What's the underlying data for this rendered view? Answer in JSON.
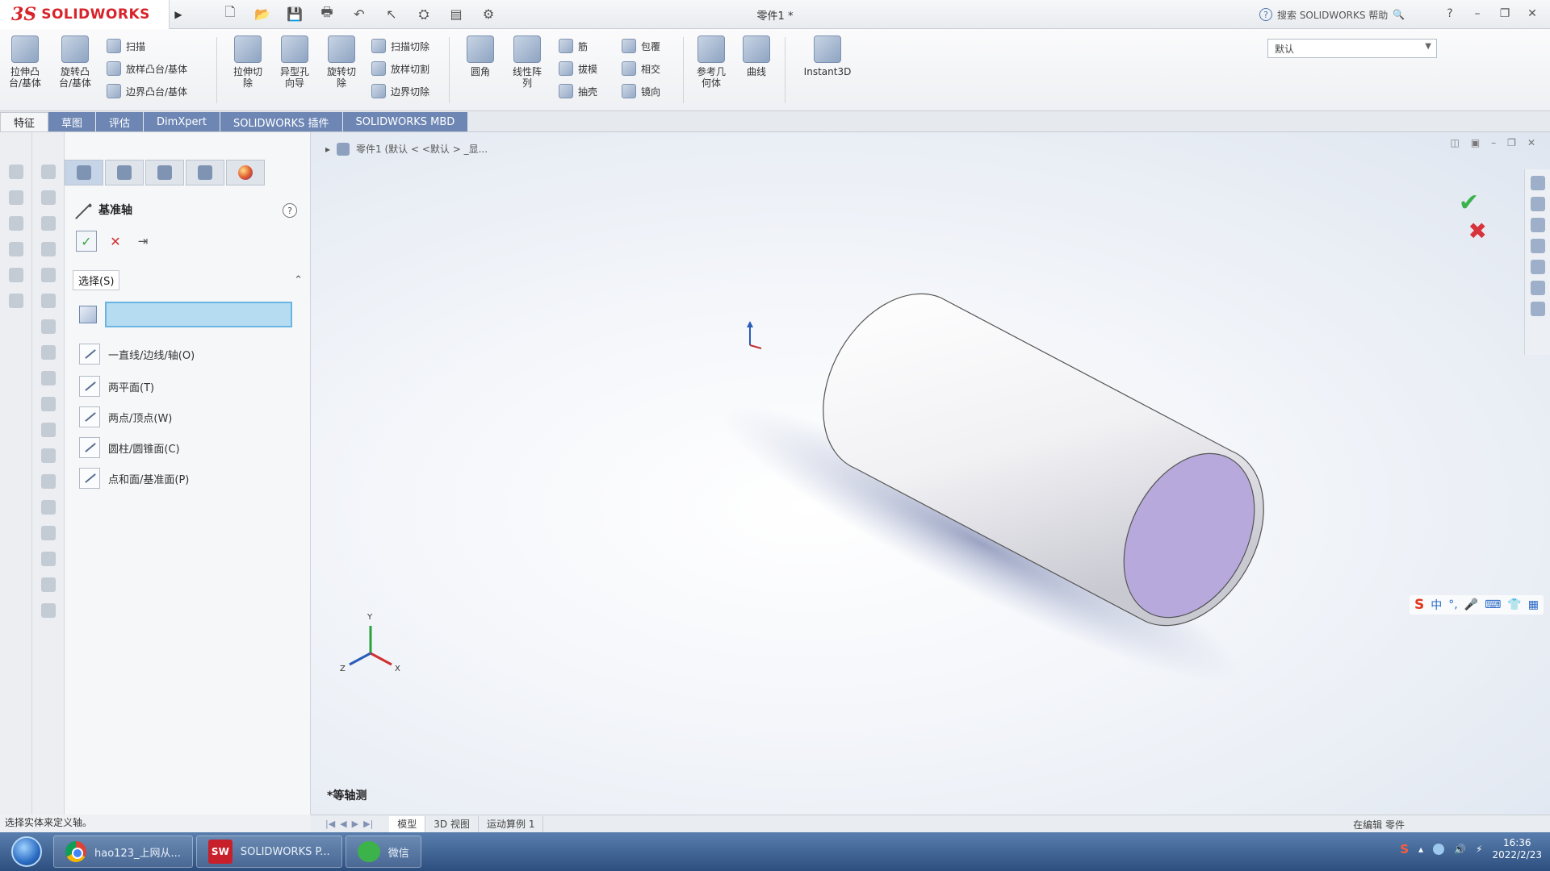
{
  "app": {
    "brand": "SOLIDWORKS",
    "doc_title": "零件1 *",
    "help_search": "搜索 SOLIDWORKS 帮助"
  },
  "ribbon": {
    "large": [
      {
        "label": "拉伸凸\n台/基体",
        "icon": "extrude-boss-icon"
      },
      {
        "label": "旋转凸\n台/基体",
        "icon": "revolve-boss-icon"
      },
      {
        "label": "拉伸切\n除",
        "icon": "extrude-cut-icon"
      },
      {
        "label": "异型孔\n向导",
        "icon": "hole-wizard-icon"
      },
      {
        "label": "旋转切\n除",
        "icon": "revolve-cut-icon"
      },
      {
        "label": "圆角",
        "icon": "fillet-icon"
      },
      {
        "label": "线性阵\n列",
        "icon": "linear-pattern-icon"
      },
      {
        "label": "参考几\n何体",
        "icon": "reference-geometry-icon"
      },
      {
        "label": "曲线",
        "icon": "curves-icon"
      },
      {
        "label": "Instant3D",
        "icon": "instant3d-icon"
      }
    ],
    "small": [
      {
        "label": "扫描",
        "icon": "sweep-icon"
      },
      {
        "label": "放样凸台/基体",
        "icon": "loft-icon"
      },
      {
        "label": "边界凸台/基体",
        "icon": "boundary-boss-icon"
      },
      {
        "label": "扫描切除",
        "icon": "swept-cut-icon"
      },
      {
        "label": "放样切割",
        "icon": "lofted-cut-icon"
      },
      {
        "label": "边界切除",
        "icon": "boundary-cut-icon"
      },
      {
        "label": "筋",
        "icon": "rib-icon"
      },
      {
        "label": "包覆",
        "icon": "wrap-icon"
      },
      {
        "label": "拔模",
        "icon": "draft-icon"
      },
      {
        "label": "相交",
        "icon": "intersect-icon"
      },
      {
        "label": "抽壳",
        "icon": "shell-icon"
      },
      {
        "label": "镜向",
        "icon": "mirror-icon"
      }
    ],
    "config_combo": "默认"
  },
  "tabs": [
    "特征",
    "草图",
    "评估",
    "DimXpert",
    "SOLIDWORKS 插件",
    "SOLIDWORKS MBD"
  ],
  "property_manager": {
    "title": "基准轴",
    "selection_label": "选择(S)",
    "options": [
      "一直线/边线/轴(O)",
      "两平面(T)",
      "两点/顶点(W)",
      "圆柱/圆锥面(C)",
      "点和面/基准面(P)"
    ]
  },
  "graphics": {
    "breadcrumb": "零件1  (默认 < <默认 > _显...",
    "view_label": "*等轴测",
    "ime": [
      "中",
      "°,",
      "🎤"
    ]
  },
  "model_tabs": [
    "模型",
    "3D 视图",
    "运动算例 1"
  ],
  "status": {
    "message": "选择实体来定义轴。",
    "editing": "在编辑 零件"
  },
  "taskbar": {
    "items": [
      {
        "label": "hao123_上网从...",
        "icon": "chrome-icon"
      },
      {
        "label": "SOLIDWORKS P...",
        "icon": "solidworks-icon"
      },
      {
        "label": "微信",
        "icon": "wechat-icon"
      }
    ],
    "time": "16:36",
    "date": "2022/2/23"
  },
  "colors": {
    "accent": "#6d86b4",
    "selection_box": "#b5dcf1",
    "cylinder_face": "#b8a9dc",
    "ok_green": "#3ab34a",
    "cancel_red": "#d8323a"
  }
}
